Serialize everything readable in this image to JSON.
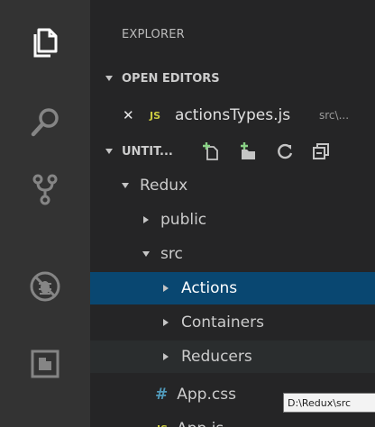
{
  "explorer": {
    "title": "EXPLORER"
  },
  "open_editors": {
    "header": "OPEN EDITORS",
    "items": [
      {
        "close": "✕",
        "badge": "JS",
        "name": "actionsTypes.js",
        "path": "src\\..."
      }
    ]
  },
  "workspace": {
    "header": "UNTIT..."
  },
  "tree": [
    {
      "label": "Redux",
      "badge": ""
    },
    {
      "label": "public",
      "badge": ""
    },
    {
      "label": "src",
      "badge": ""
    },
    {
      "label": "Actions",
      "badge": ""
    },
    {
      "label": "Containers",
      "badge": ""
    },
    {
      "label": "Reducers",
      "badge": ""
    },
    {
      "label": "App.css",
      "badge": "#"
    },
    {
      "label": "App.js",
      "badge": "JS"
    }
  ],
  "tooltip": {
    "text": "D:\\Redux\\src"
  },
  "colors": {
    "activity_bar": "#333333",
    "sidebar": "#252526",
    "selected": "#094771",
    "js_badge": "#cbcb41",
    "css_badge": "#519aba"
  },
  "icons": {
    "activity": [
      "files-icon",
      "search-icon",
      "source-control-icon",
      "debug-icon",
      "extensions-icon"
    ],
    "toolbar": [
      "new-file-icon",
      "new-folder-icon",
      "refresh-icon",
      "collapse-all-icon"
    ]
  }
}
